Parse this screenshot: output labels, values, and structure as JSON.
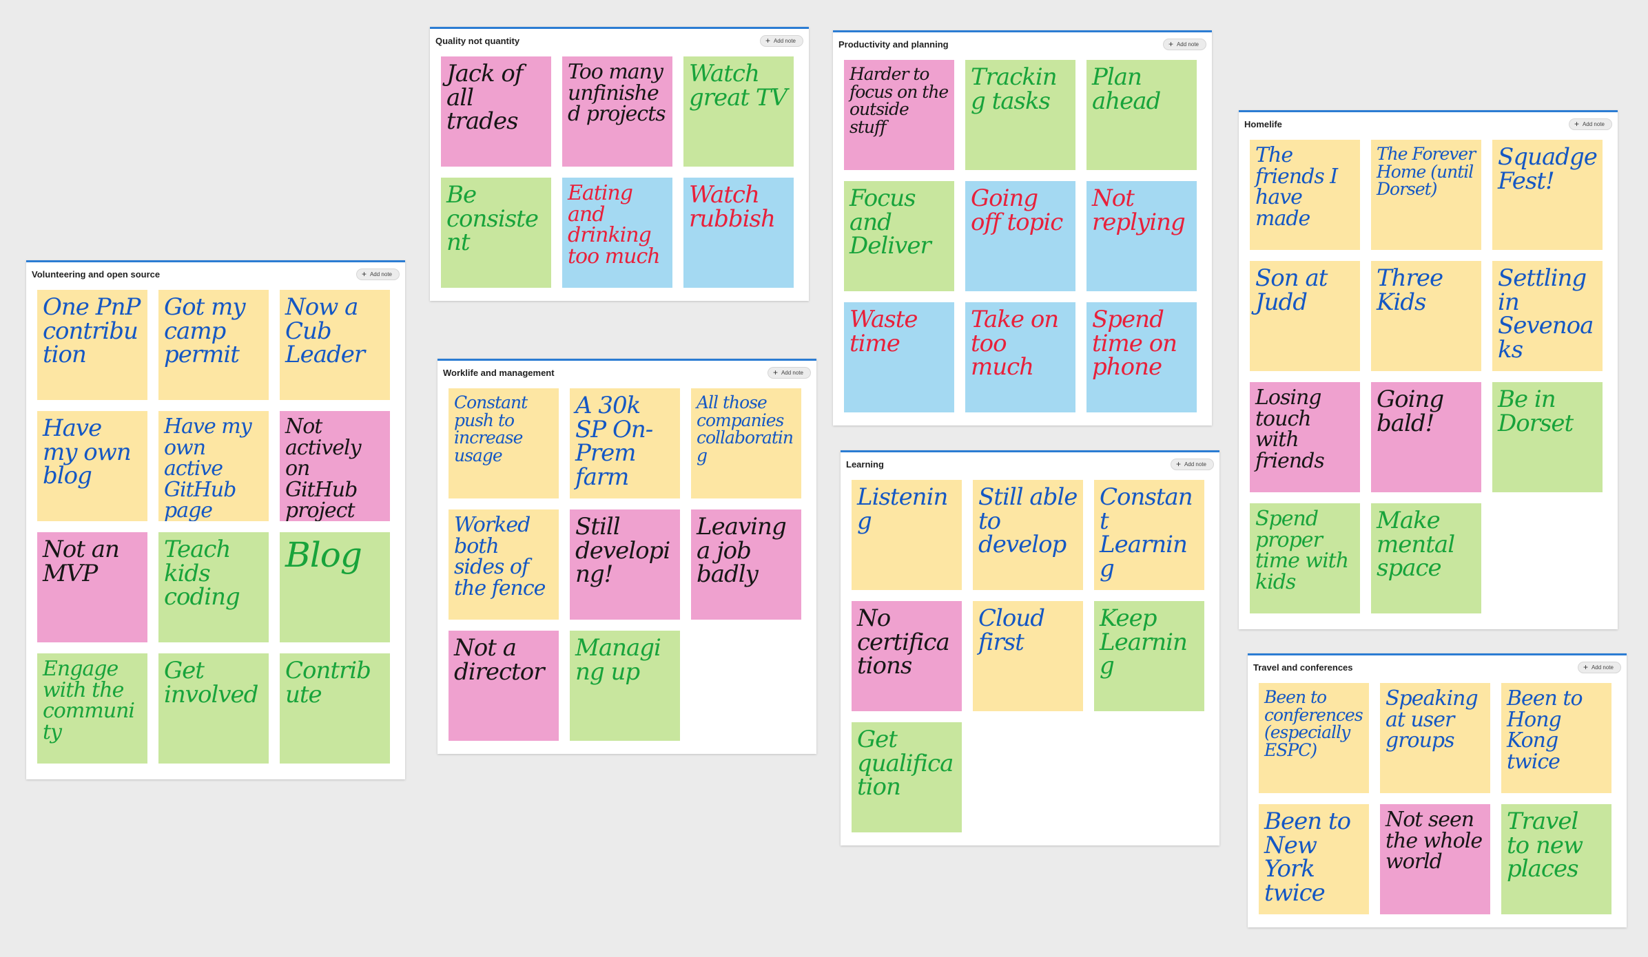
{
  "boards": {
    "volunteering": {
      "title": "Volunteering and open source",
      "add_label": "Add note",
      "notes": [
        {
          "text": "One PnP contribution",
          "color": "yellow",
          "ink": "blue"
        },
        {
          "text": "Got my camp permit",
          "color": "yellow",
          "ink": "blue"
        },
        {
          "text": "Now a Cub Leader",
          "color": "yellow",
          "ink": "blue"
        },
        {
          "text": "Have my own blog",
          "color": "yellow",
          "ink": "blue"
        },
        {
          "text": "Have my own active GitHub page",
          "color": "yellow",
          "ink": "blue"
        },
        {
          "text": "Not actively on GitHub project",
          "color": "pink",
          "ink": "black"
        },
        {
          "text": "Not an MVP",
          "color": "pink",
          "ink": "black"
        },
        {
          "text": "Teach kids coding",
          "color": "green",
          "ink": "green"
        },
        {
          "text": "Blog",
          "color": "green",
          "ink": "green"
        },
        {
          "text": "Engage with the community",
          "color": "green",
          "ink": "green"
        },
        {
          "text": "Get involved",
          "color": "green",
          "ink": "green"
        },
        {
          "text": "Contribute",
          "color": "green",
          "ink": "green"
        }
      ]
    },
    "quality": {
      "title": "Quality not quantity",
      "add_label": "Add note",
      "notes": [
        {
          "text": "Jack of all trades",
          "color": "pink",
          "ink": "black"
        },
        {
          "text": "Too many unfinished projects",
          "color": "pink",
          "ink": "black"
        },
        {
          "text": "Watch great TV",
          "color": "green",
          "ink": "green"
        },
        {
          "text": "Be consistent",
          "color": "green",
          "ink": "green"
        },
        {
          "text": "Eating and drinking too much",
          "color": "blue",
          "ink": "red"
        },
        {
          "text": "Watch rubbish",
          "color": "blue",
          "ink": "red"
        }
      ]
    },
    "worklife": {
      "title": "Worklife and management",
      "add_label": "Add note",
      "notes": [
        {
          "text": "Constant push to increase usage",
          "color": "yellow",
          "ink": "blue"
        },
        {
          "text": "A 30k SP On-Prem farm",
          "color": "yellow",
          "ink": "blue"
        },
        {
          "text": "All those companies collaborating",
          "color": "yellow",
          "ink": "blue"
        },
        {
          "text": "Worked both sides of the fence",
          "color": "yellow",
          "ink": "blue"
        },
        {
          "text": "Still developing!",
          "color": "pink",
          "ink": "black"
        },
        {
          "text": "Leaving a job badly",
          "color": "pink",
          "ink": "black"
        },
        {
          "text": "Not a director",
          "color": "pink",
          "ink": "black"
        },
        {
          "text": "Managing up",
          "color": "green",
          "ink": "green"
        }
      ]
    },
    "productivity": {
      "title": "Productivity and planning",
      "add_label": "Add note",
      "notes": [
        {
          "text": "Harder to focus on the outside stuff",
          "color": "pink",
          "ink": "black"
        },
        {
          "text": "Tracking tasks",
          "color": "green",
          "ink": "green"
        },
        {
          "text": "Plan ahead",
          "color": "green",
          "ink": "green"
        },
        {
          "text": "Focus and Deliver",
          "color": "green",
          "ink": "green"
        },
        {
          "text": "Going off topic",
          "color": "blue",
          "ink": "red"
        },
        {
          "text": "Not replying",
          "color": "blue",
          "ink": "red"
        },
        {
          "text": "Waste time",
          "color": "blue",
          "ink": "red"
        },
        {
          "text": "Take on too much",
          "color": "blue",
          "ink": "red"
        },
        {
          "text": "Spend time on phone",
          "color": "blue",
          "ink": "red"
        }
      ]
    },
    "learning": {
      "title": "Learning",
      "add_label": "Add note",
      "notes": [
        {
          "text": "Listening",
          "color": "yellow",
          "ink": "blue"
        },
        {
          "text": "Still able to develop",
          "color": "yellow",
          "ink": "blue"
        },
        {
          "text": "Constant Learning",
          "color": "yellow",
          "ink": "blue"
        },
        {
          "text": "No certifications",
          "color": "pink",
          "ink": "black"
        },
        {
          "text": "Cloud first",
          "color": "yellow",
          "ink": "blue"
        },
        {
          "text": "Keep Learning",
          "color": "green",
          "ink": "green"
        },
        {
          "text": "Get qualification",
          "color": "green",
          "ink": "green"
        }
      ]
    },
    "homelife": {
      "title": "Homelife",
      "add_label": "Add note",
      "notes": [
        {
          "text": "The friends I have made",
          "color": "yellow",
          "ink": "blue"
        },
        {
          "text": "The Forever Home (until Dorset)",
          "color": "yellow",
          "ink": "blue"
        },
        {
          "text": "SquadgeFest!",
          "color": "yellow",
          "ink": "blue"
        },
        {
          "text": "Son at Judd",
          "color": "yellow",
          "ink": "blue"
        },
        {
          "text": "Three Kids",
          "color": "yellow",
          "ink": "blue"
        },
        {
          "text": "Settling in Sevenoaks",
          "color": "yellow",
          "ink": "blue"
        },
        {
          "text": "Losing touch with friends",
          "color": "pink",
          "ink": "black"
        },
        {
          "text": "Going bald!",
          "color": "pink",
          "ink": "black"
        },
        {
          "text": "Be in Dorset",
          "color": "green",
          "ink": "green"
        },
        {
          "text": "Spend proper time with kids",
          "color": "green",
          "ink": "green"
        },
        {
          "text": "Make mental space",
          "color": "green",
          "ink": "green"
        }
      ]
    },
    "travel": {
      "title": "Travel and conferences",
      "add_label": "Add note",
      "notes": [
        {
          "text": "Been to conferences (especially ESPC)",
          "color": "yellow",
          "ink": "blue"
        },
        {
          "text": "Speaking at user groups",
          "color": "yellow",
          "ink": "blue"
        },
        {
          "text": "Been to Hong Kong twice",
          "color": "yellow",
          "ink": "blue"
        },
        {
          "text": "Been to New York twice",
          "color": "yellow",
          "ink": "blue"
        },
        {
          "text": "Not seen the whole world",
          "color": "pink",
          "ink": "black"
        },
        {
          "text": "Travel to new places",
          "color": "green",
          "ink": "green"
        }
      ]
    }
  }
}
